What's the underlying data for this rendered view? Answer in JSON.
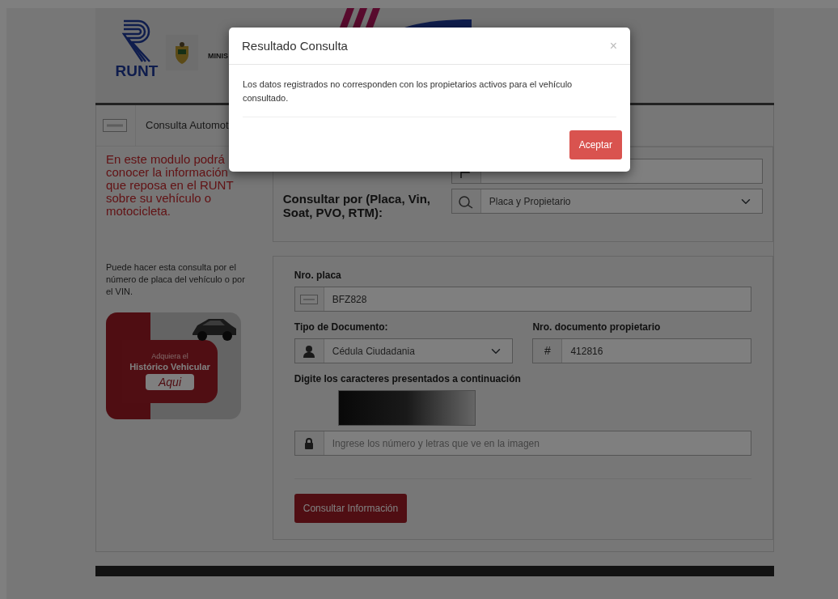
{
  "header": {
    "logo_text": "RUNT",
    "ministry_text": "MINIS"
  },
  "tab": {
    "label": "Consulta Automot"
  },
  "intro_text": "En este modulo podrá conocer la información que reposa en el RUNT sobre su vehículo o motocicleta.",
  "side_note": "Puede hacer esta consulta por el número de placa del vehículo o por el VIN.",
  "promo": {
    "line1": "Adquiera el",
    "line2": "Histórico Vehicular",
    "button": "Aqui"
  },
  "query_panel": {
    "fields": [
      {
        "kind": "flag"
      },
      {
        "label": "Consultar por (Placa, Vin, Soat, PVO, RTM):",
        "value": "Placa y Propietario",
        "kind": "search"
      }
    ]
  },
  "form": {
    "plate": {
      "label": "Nro. placa",
      "value": "BFZ828"
    },
    "doc_type": {
      "label": "Tipo de Documento:",
      "value": "Cédula Ciudadania"
    },
    "doc_number": {
      "label": "Nro. documento propietario",
      "value": "412816",
      "symbol": "#"
    },
    "captcha": {
      "label": "Digite los caracteres presentados a continuación",
      "placeholder": "Ingrese los número y letras que ve en la imagen"
    },
    "submit": "Consultar Información"
  },
  "modal": {
    "title": "Resultado Consulta",
    "close": "×",
    "message": "Los datos registrados no corresponden con los propietarios activos para el vehículo consultado.",
    "button": "Aceptar"
  }
}
